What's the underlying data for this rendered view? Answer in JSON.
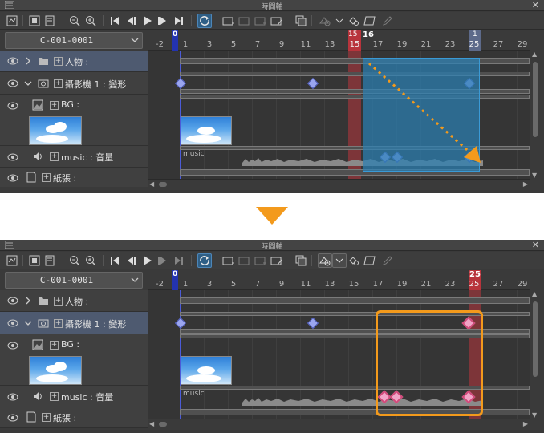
{
  "window": {
    "title": "時間軸"
  },
  "timeline_name": "C-001-0001",
  "ruler": {
    "labels": [
      "-2",
      "1",
      "3",
      "5",
      "7",
      "9",
      "11",
      "13",
      "15",
      "17",
      "19",
      "21",
      "23",
      "25",
      "27",
      "29"
    ],
    "zero_marker": "0"
  },
  "layers": [
    {
      "label": "人物 :",
      "kind": "folder"
    },
    {
      "label": "攝影機 1 : 變形",
      "kind": "camera"
    },
    {
      "label": "BG :",
      "kind": "image"
    },
    {
      "label": "music : 音量",
      "kind": "audio"
    },
    {
      "label": "紙張 :",
      "kind": "paper"
    }
  ],
  "music_clip_label": "music",
  "before": {
    "range_start_label": "15",
    "range_end_label": "16",
    "playhead_label": "1",
    "playhead_frame_sub": "25"
  },
  "after": {
    "playhead_label": "25",
    "playhead_frame_sub": "25"
  },
  "colors": {
    "selection_fill": "#2b7fb3",
    "accent_orange": "#f39a1c",
    "playhead_red": "#c0303a",
    "keyframe": "#9aa5ee",
    "keyframe_selected": "#f1a4c7"
  },
  "icons": [
    "menu-icon",
    "close-icon",
    "new-timeline-icon",
    "timeline-settings-icon",
    "zoom-out-icon",
    "zoom-in-icon",
    "first-frame-icon",
    "prev-frame-icon",
    "play-icon",
    "next-frame-icon",
    "last-frame-icon",
    "loop-icon",
    "new-animation-folder-icon",
    "specify-cels-icon",
    "delete-cel-icon",
    "keyframe-mode-icon",
    "onion-skin-icon",
    "light-table-icon",
    "edit-icon"
  ]
}
